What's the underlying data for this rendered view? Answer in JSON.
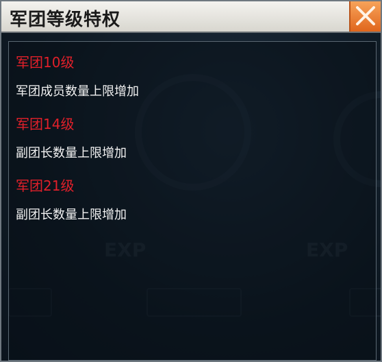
{
  "dialog": {
    "title": "军团等级特权",
    "close_icon": "close-icon",
    "accent": "#e0202a"
  },
  "privileges": [
    {
      "level": "军团10级",
      "description": "军团成员数量上限增加"
    },
    {
      "level": "军团14级",
      "description": "副团长数量上限增加"
    },
    {
      "level": "军团21级",
      "description": "副团长数量上限增加"
    }
  ]
}
